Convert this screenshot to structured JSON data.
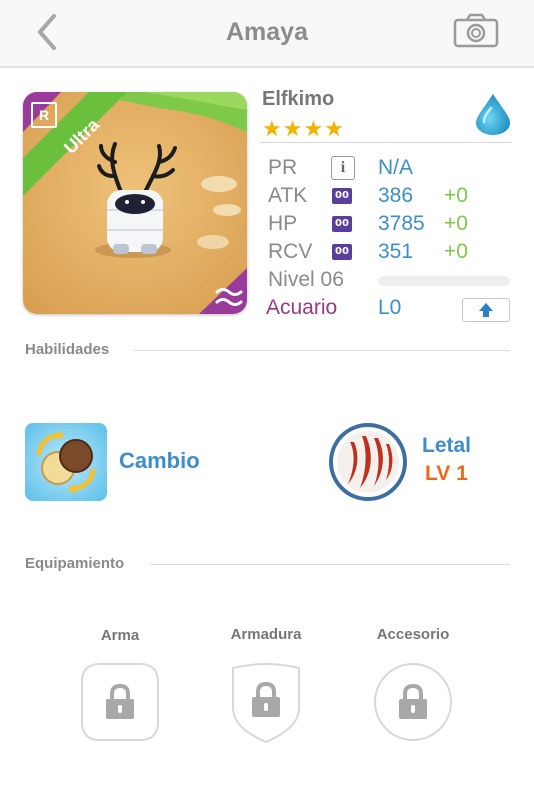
{
  "header": {
    "title": "Amaya",
    "back_icon": "chevron-left-icon",
    "camera_icon": "camera-icon"
  },
  "monster": {
    "rank_badge": "R",
    "rarity": "Ultra",
    "name": "Elfkimo",
    "stars": "★★★★",
    "star_count": 4,
    "element_icon": "water-drop-icon",
    "stats": {
      "pr": {
        "label": "PR",
        "value": "N/A"
      },
      "atk": {
        "label": "ATK",
        "badge": "00",
        "value": "386",
        "bonus": "+0"
      },
      "hp": {
        "label": "HP",
        "badge": "00",
        "value": "3785",
        "bonus": "+0"
      },
      "rcv": {
        "label": "RCV",
        "badge": "00",
        "value": "351",
        "bonus": "+0"
      }
    },
    "level_label": "Nivel 06",
    "level_progress": 0,
    "zodiac": "Acuario",
    "zodiac_level": "L0"
  },
  "abilities": {
    "section_title": "Habilidades",
    "skill": {
      "name": "Cambio"
    },
    "ability": {
      "name": "Letal",
      "level": "LV 1"
    }
  },
  "equipment": {
    "section_title": "Equipamiento",
    "slots": [
      {
        "label": "Arma"
      },
      {
        "label": "Armadura"
      },
      {
        "label": "Accesorio"
      }
    ]
  },
  "colors": {
    "accent_blue": "#3c8fc8",
    "bonus_green": "#7cc84a",
    "zodiac_purple": "#9a3a7e",
    "level_orange": "#ec6a1a",
    "rarity_green": "#6abf3c"
  }
}
